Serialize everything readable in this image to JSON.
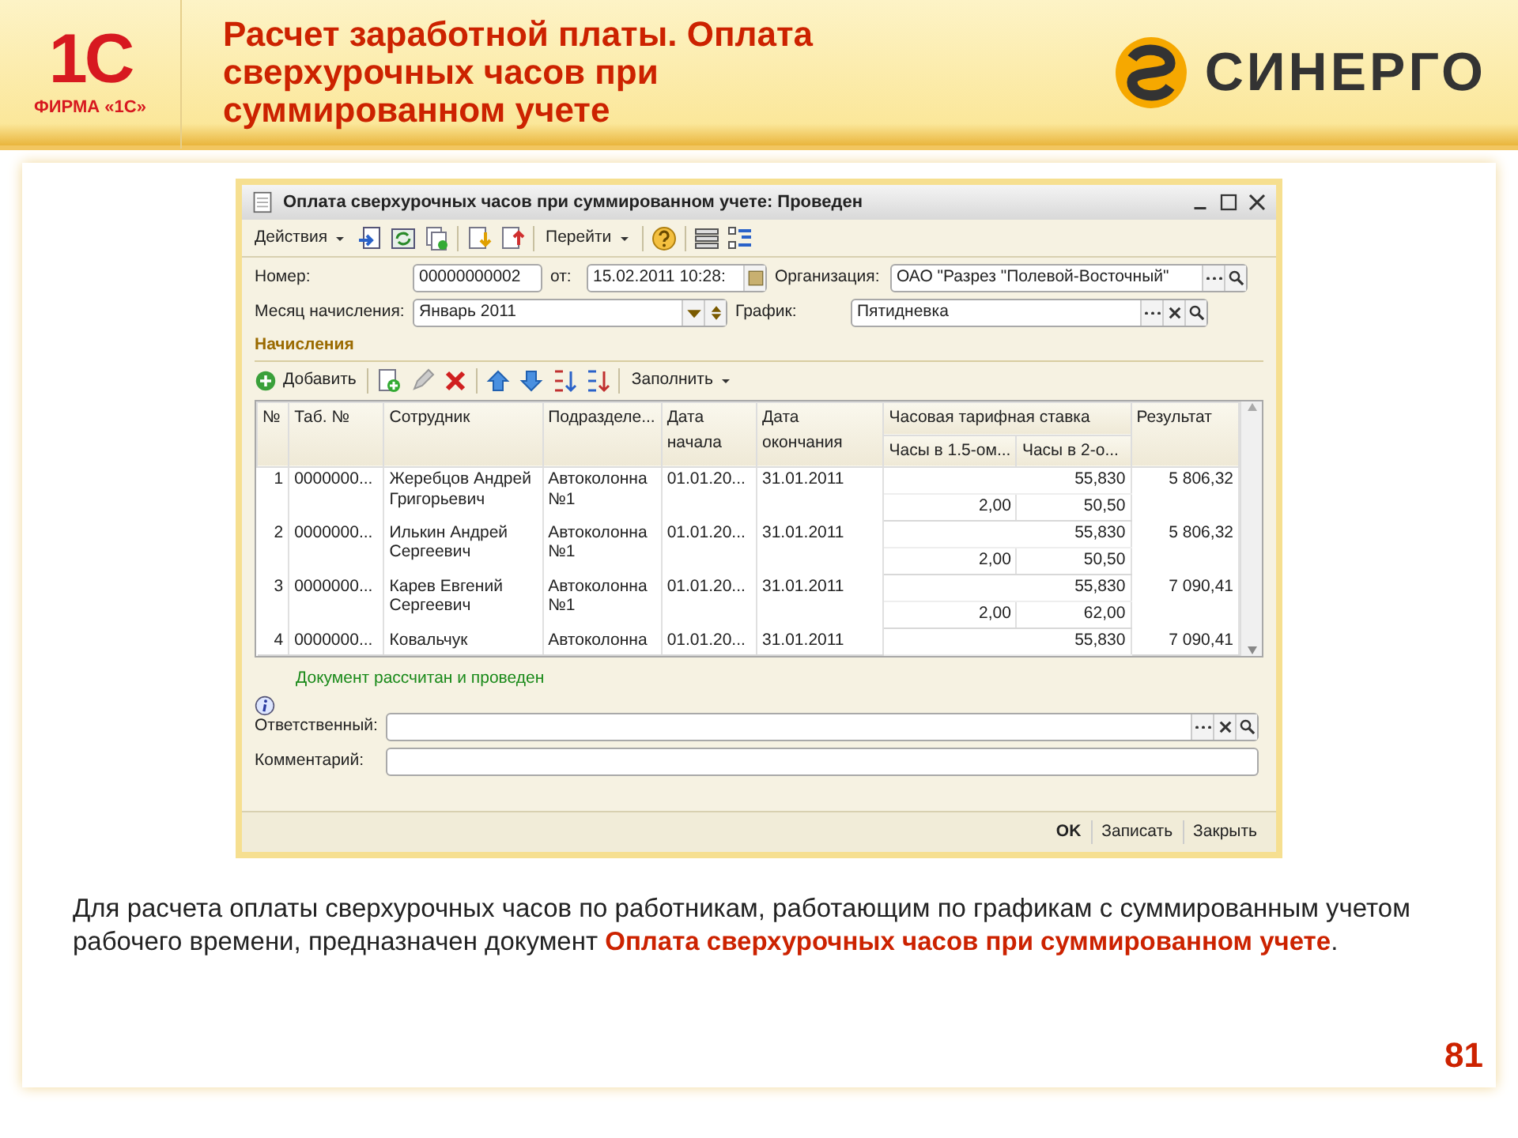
{
  "header": {
    "logo_1c": {
      "mark": "1С",
      "caption": "ФИРМА «1С»"
    },
    "title": "Расчет заработной платы. Оплата сверхурочных часов при суммированном учете",
    "logo_partner": "СИНЕРГО"
  },
  "window": {
    "title": "Оплата сверхурочных часов при суммированном учете: Проведен",
    "toolbar": [
      {
        "kind": "menu",
        "label": "Действия"
      },
      {
        "kind": "icon"
      },
      {
        "kind": "icon"
      },
      {
        "kind": "icon"
      },
      {
        "kind": "sep"
      },
      {
        "kind": "icon"
      },
      {
        "kind": "icon"
      },
      {
        "kind": "sep"
      },
      {
        "kind": "menu",
        "label": "Перейти"
      },
      {
        "kind": "sep"
      },
      {
        "kind": "icon"
      },
      {
        "kind": "sep"
      },
      {
        "kind": "icon"
      },
      {
        "kind": "icon"
      }
    ],
    "fields": {
      "number_label": "Номер:",
      "number": "00000000002",
      "date_label": "от:",
      "date": "15.02.2011 10:28:",
      "org_label": "Организация:",
      "org": "ОАО \"Разрез \"Полевой-Восточный\"",
      "month_label": "Месяц начисления:",
      "month": "Январь 2011",
      "schedule_label": "График:",
      "schedule": "Пятидневка"
    },
    "section_title": "Начисления",
    "table_toolbar": [
      {
        "kind": "add",
        "label": "Добавить"
      },
      {
        "kind": "sep"
      },
      {
        "kind": "icon"
      },
      {
        "kind": "icon"
      },
      {
        "kind": "icon"
      },
      {
        "kind": "sep"
      },
      {
        "kind": "icon"
      },
      {
        "kind": "icon"
      },
      {
        "kind": "icon"
      },
      {
        "kind": "icon"
      },
      {
        "kind": "sep"
      },
      {
        "kind": "menu",
        "label": "Заполнить"
      }
    ],
    "table": {
      "columns": [
        "№",
        "Таб. №",
        "Сотрудник",
        "Подразделе...",
        "Дата начала",
        "Дата окончания"
      ],
      "group_column": "Часовая тарифная ставка",
      "sub_columns": [
        "Часы в 1.5-ом...",
        "Часы в 2-о..."
      ],
      "result_column": "Результат",
      "rows": [
        {
          "n": "1",
          "tab": "0000000...",
          "employee": "Жеребцов Андрей Григорьевич",
          "dept": "Автоколонна №1",
          "start": "01.01.20...",
          "end": "31.01.2011",
          "rate": "55,830",
          "hours_15": "2,00",
          "hours_2": "50,50",
          "result": "5 806,32"
        },
        {
          "n": "2",
          "tab": "0000000...",
          "employee": "Илькин Андрей Сергеевич",
          "dept": "Автоколонна №1",
          "start": "01.01.20...",
          "end": "31.01.2011",
          "rate": "55,830",
          "hours_15": "2,00",
          "hours_2": "50,50",
          "result": "5 806,32"
        },
        {
          "n": "3",
          "tab": "0000000...",
          "employee": "Карев Евгений Сергеевич",
          "dept": "Автоколонна №1",
          "start": "01.01.20...",
          "end": "31.01.2011",
          "rate": "55,830",
          "hours_15": "2,00",
          "hours_2": "62,00",
          "result": "7 090,41"
        },
        {
          "n": "4",
          "tab": "0000000...",
          "employee": "Ковальчук",
          "dept": "Автоколонна",
          "start": "01.01.20...",
          "end": "31.01.2011",
          "rate": "55,830",
          "result": "7 090,41"
        }
      ]
    },
    "status_message": "Документ рассчитан и проведен",
    "responsible_label": "Ответственный:",
    "comment_label": "Комментарий:",
    "buttons": [
      {
        "label": "OK",
        "default": true
      },
      {
        "label": "Записать",
        "default": false
      },
      {
        "label": "Закрыть",
        "default": false
      }
    ]
  },
  "description": "Для расчета оплаты сверхурочных часов по работникам, работающим по графикам с суммированным учетом рабочего времени, предназначен документ **Оплата сверхурочных часов при суммированном учете**.",
  "page_number": "81"
}
